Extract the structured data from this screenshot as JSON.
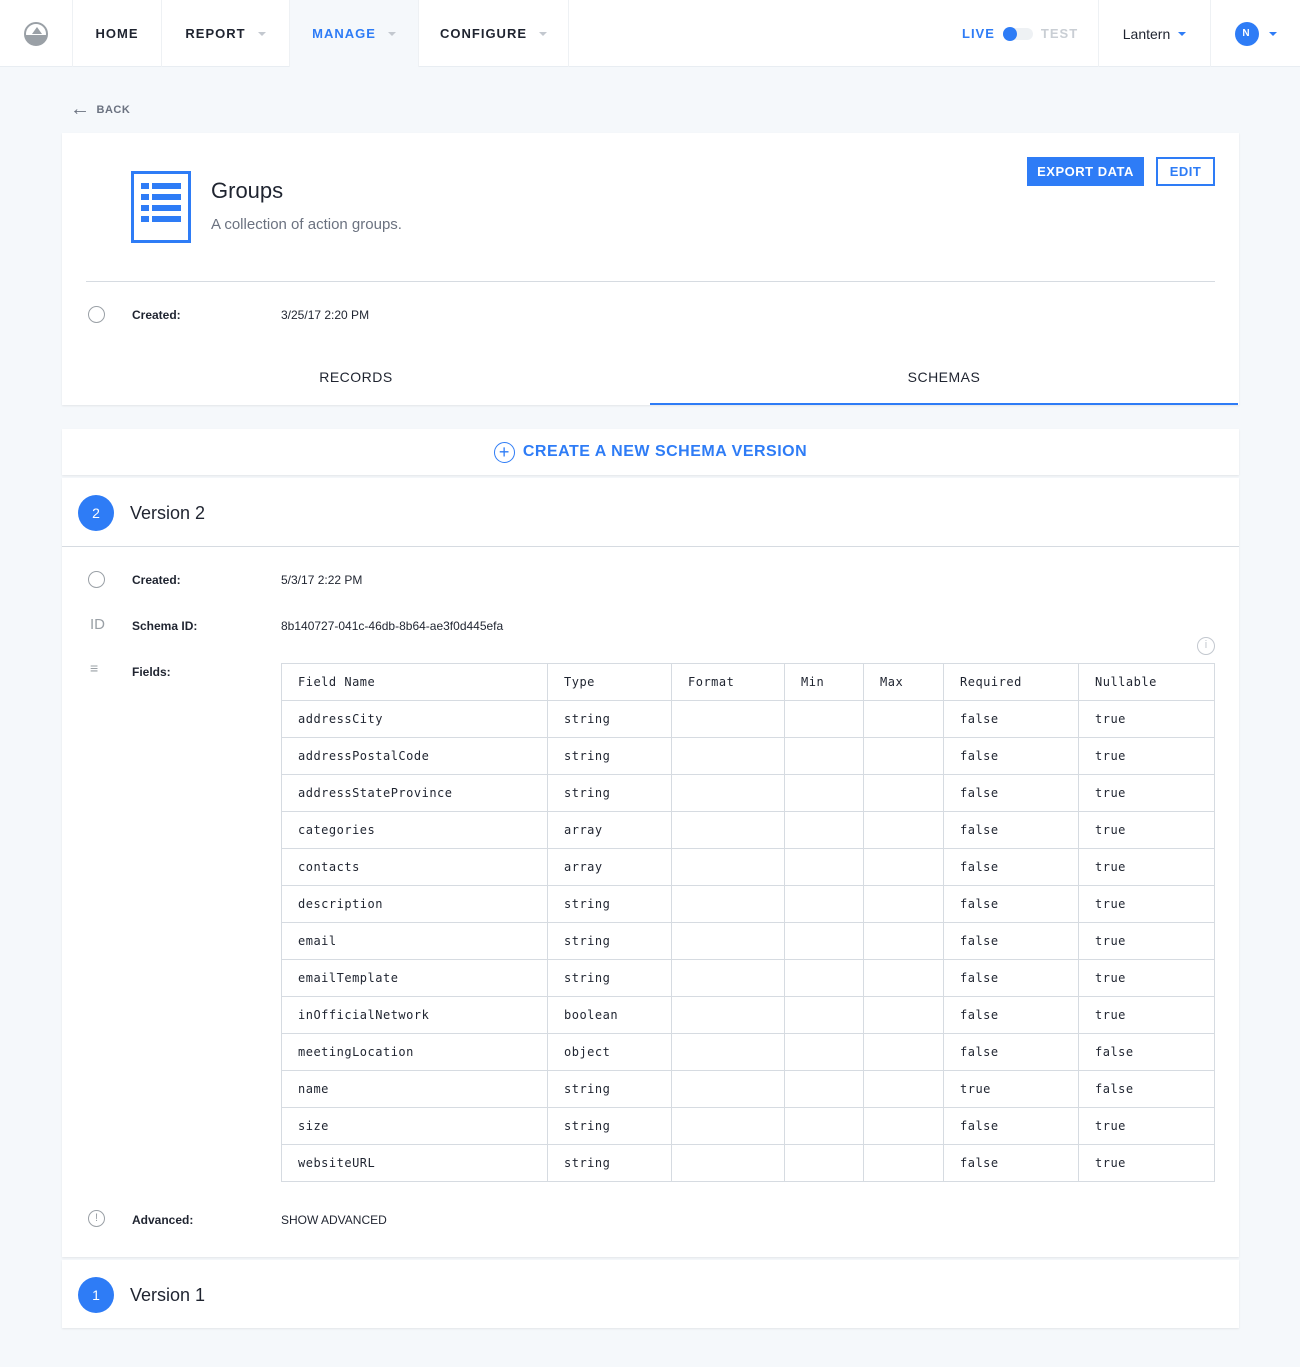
{
  "nav": {
    "items": [
      {
        "label": "HOME"
      },
      {
        "label": "REPORT"
      },
      {
        "label": "MANAGE"
      },
      {
        "label": "CONFIGURE"
      }
    ],
    "live": "LIVE",
    "test": "TEST",
    "org": "Lantern",
    "avatar": "N"
  },
  "back": "BACK",
  "dataset": {
    "title": "Groups",
    "description": "A collection of action groups.",
    "export": "EXPORT DATA",
    "edit": "EDIT",
    "created_label": "Created:",
    "created": "3/25/17 2:20 PM"
  },
  "tabs": [
    {
      "label": "RECORDS"
    },
    {
      "label": "SCHEMAS"
    }
  ],
  "create": "CREATE A NEW SCHEMA VERSION",
  "version2": {
    "num": "2",
    "title": "Version 2",
    "created_label": "Created:",
    "created": "5/3/17 2:22 PM",
    "id_icon": "ID",
    "id_label": "Schema ID:",
    "id": "8b140727-041c-46db-8b64-ae3f0d445efa",
    "fields_label": "Fields:",
    "advanced_label": "Advanced:",
    "advanced": "SHOW ADVANCED"
  },
  "table": {
    "headers": [
      "Field Name",
      "Type",
      "Format",
      "Min",
      "Max",
      "Required",
      "Nullable"
    ],
    "rows": [
      [
        "addressCity",
        "string",
        "",
        "",
        "",
        "false",
        "true"
      ],
      [
        "addressPostalCode",
        "string",
        "",
        "",
        "",
        "false",
        "true"
      ],
      [
        "addressStateProvince",
        "string",
        "",
        "",
        "",
        "false",
        "true"
      ],
      [
        "categories",
        "array",
        "",
        "",
        "",
        "false",
        "true"
      ],
      [
        "contacts",
        "array",
        "",
        "",
        "",
        "false",
        "true"
      ],
      [
        "description",
        "string",
        "",
        "",
        "",
        "false",
        "true"
      ],
      [
        "email",
        "string",
        "",
        "",
        "",
        "false",
        "true"
      ],
      [
        "emailTemplate",
        "string",
        "",
        "",
        "",
        "false",
        "true"
      ],
      [
        "inOfficialNetwork",
        "boolean",
        "",
        "",
        "",
        "false",
        "true"
      ],
      [
        "meetingLocation",
        "object",
        "",
        "",
        "",
        "false",
        "false"
      ],
      [
        "name",
        "string",
        "",
        "",
        "",
        "true",
        "false"
      ],
      [
        "size",
        "string",
        "",
        "",
        "",
        "false",
        "true"
      ],
      [
        "websiteURL",
        "string",
        "",
        "",
        "",
        "false",
        "true"
      ]
    ]
  },
  "version1": {
    "num": "1",
    "title": "Version 1"
  },
  "colors": {
    "accent": "#2e7cf6",
    "bg": "#f5f8fb"
  }
}
